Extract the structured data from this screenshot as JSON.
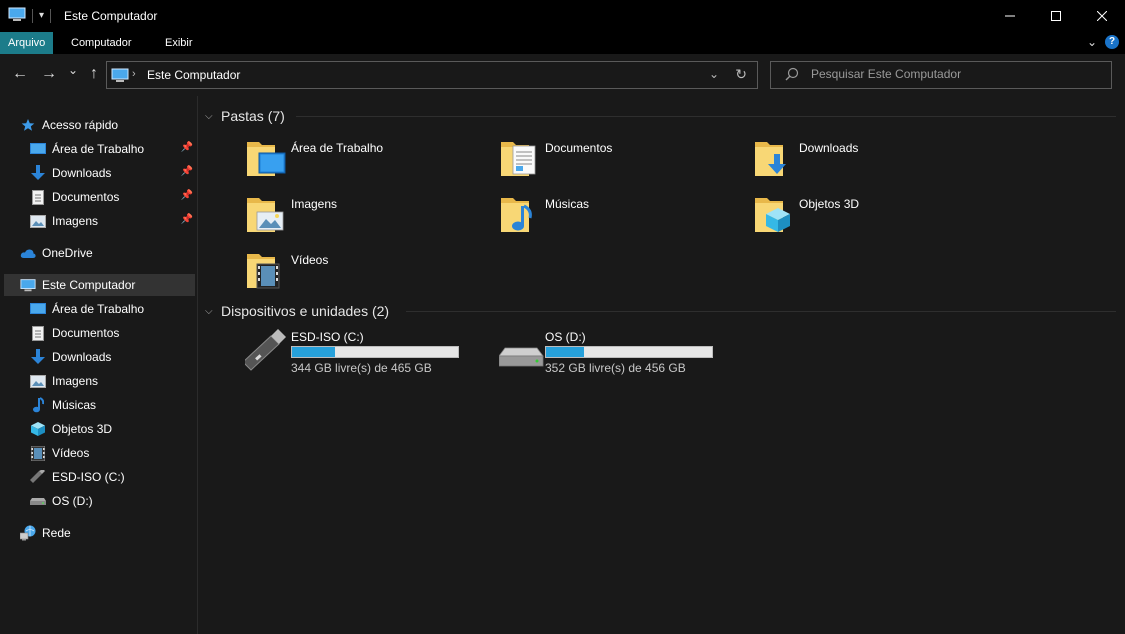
{
  "window": {
    "title": "Este Computador"
  },
  "ribbon": {
    "tabs": [
      {
        "label": "Arquivo"
      },
      {
        "label": "Computador"
      },
      {
        "label": "Exibir"
      }
    ],
    "help": "?"
  },
  "nav": {
    "back": "←",
    "forward": "→",
    "recent": "⌄",
    "up": "↑",
    "crumb_sep": "›",
    "crumb": "Este Computador",
    "search_placeholder": "Pesquisar Este Computador"
  },
  "sidebar": {
    "items": [
      {
        "label": "Acesso rápido",
        "icon": "star-icon"
      },
      {
        "label": "Área de Trabalho",
        "icon": "desktop-icon",
        "pinned": true
      },
      {
        "label": "Downloads",
        "icon": "download-icon",
        "pinned": true
      },
      {
        "label": "Documentos",
        "icon": "document-icon",
        "pinned": true
      },
      {
        "label": "Imagens",
        "icon": "image-icon",
        "pinned": true
      },
      {
        "label": "OneDrive",
        "icon": "cloud-icon"
      },
      {
        "label": "Este Computador",
        "icon": "computer-icon",
        "selected": true
      },
      {
        "label": "Área de Trabalho",
        "icon": "desktop-icon"
      },
      {
        "label": "Documentos",
        "icon": "document-icon"
      },
      {
        "label": "Downloads",
        "icon": "download-icon"
      },
      {
        "label": "Imagens",
        "icon": "image-icon"
      },
      {
        "label": "Músicas",
        "icon": "music-icon"
      },
      {
        "label": "Objetos 3D",
        "icon": "cube-icon"
      },
      {
        "label": "Vídeos",
        "icon": "video-icon"
      },
      {
        "label": "ESD-ISO (C:)",
        "icon": "usb-drive-icon"
      },
      {
        "label": "OS (D:)",
        "icon": "hard-drive-icon"
      },
      {
        "label": "Rede",
        "icon": "network-icon"
      }
    ]
  },
  "content": {
    "folders_header": "Pastas (7)",
    "folders": [
      {
        "label": "Área de Trabalho",
        "icon": "desktop-folder-icon"
      },
      {
        "label": "Documentos",
        "icon": "documents-folder-icon"
      },
      {
        "label": "Downloads",
        "icon": "downloads-folder-icon"
      },
      {
        "label": "Imagens",
        "icon": "pictures-folder-icon"
      },
      {
        "label": "Músicas",
        "icon": "music-folder-icon"
      },
      {
        "label": "Objetos 3D",
        "icon": "3d-objects-folder-icon"
      },
      {
        "label": "Vídeos",
        "icon": "videos-folder-icon"
      }
    ],
    "drives_header": "Dispositivos e unidades (2)",
    "drives": [
      {
        "name": "ESD-ISO (C:)",
        "free": "344 GB livre(s) de 465 GB",
        "used_fraction": 0.26,
        "icon": "usb-drive-icon"
      },
      {
        "name": "OS (D:)",
        "free": "352 GB livre(s) de 456 GB",
        "used_fraction": 0.23,
        "icon": "hard-drive-icon"
      }
    ]
  },
  "colors": {
    "accent": "#1c7c8a",
    "bar_fill": "#26a0da",
    "background": "#191919"
  }
}
